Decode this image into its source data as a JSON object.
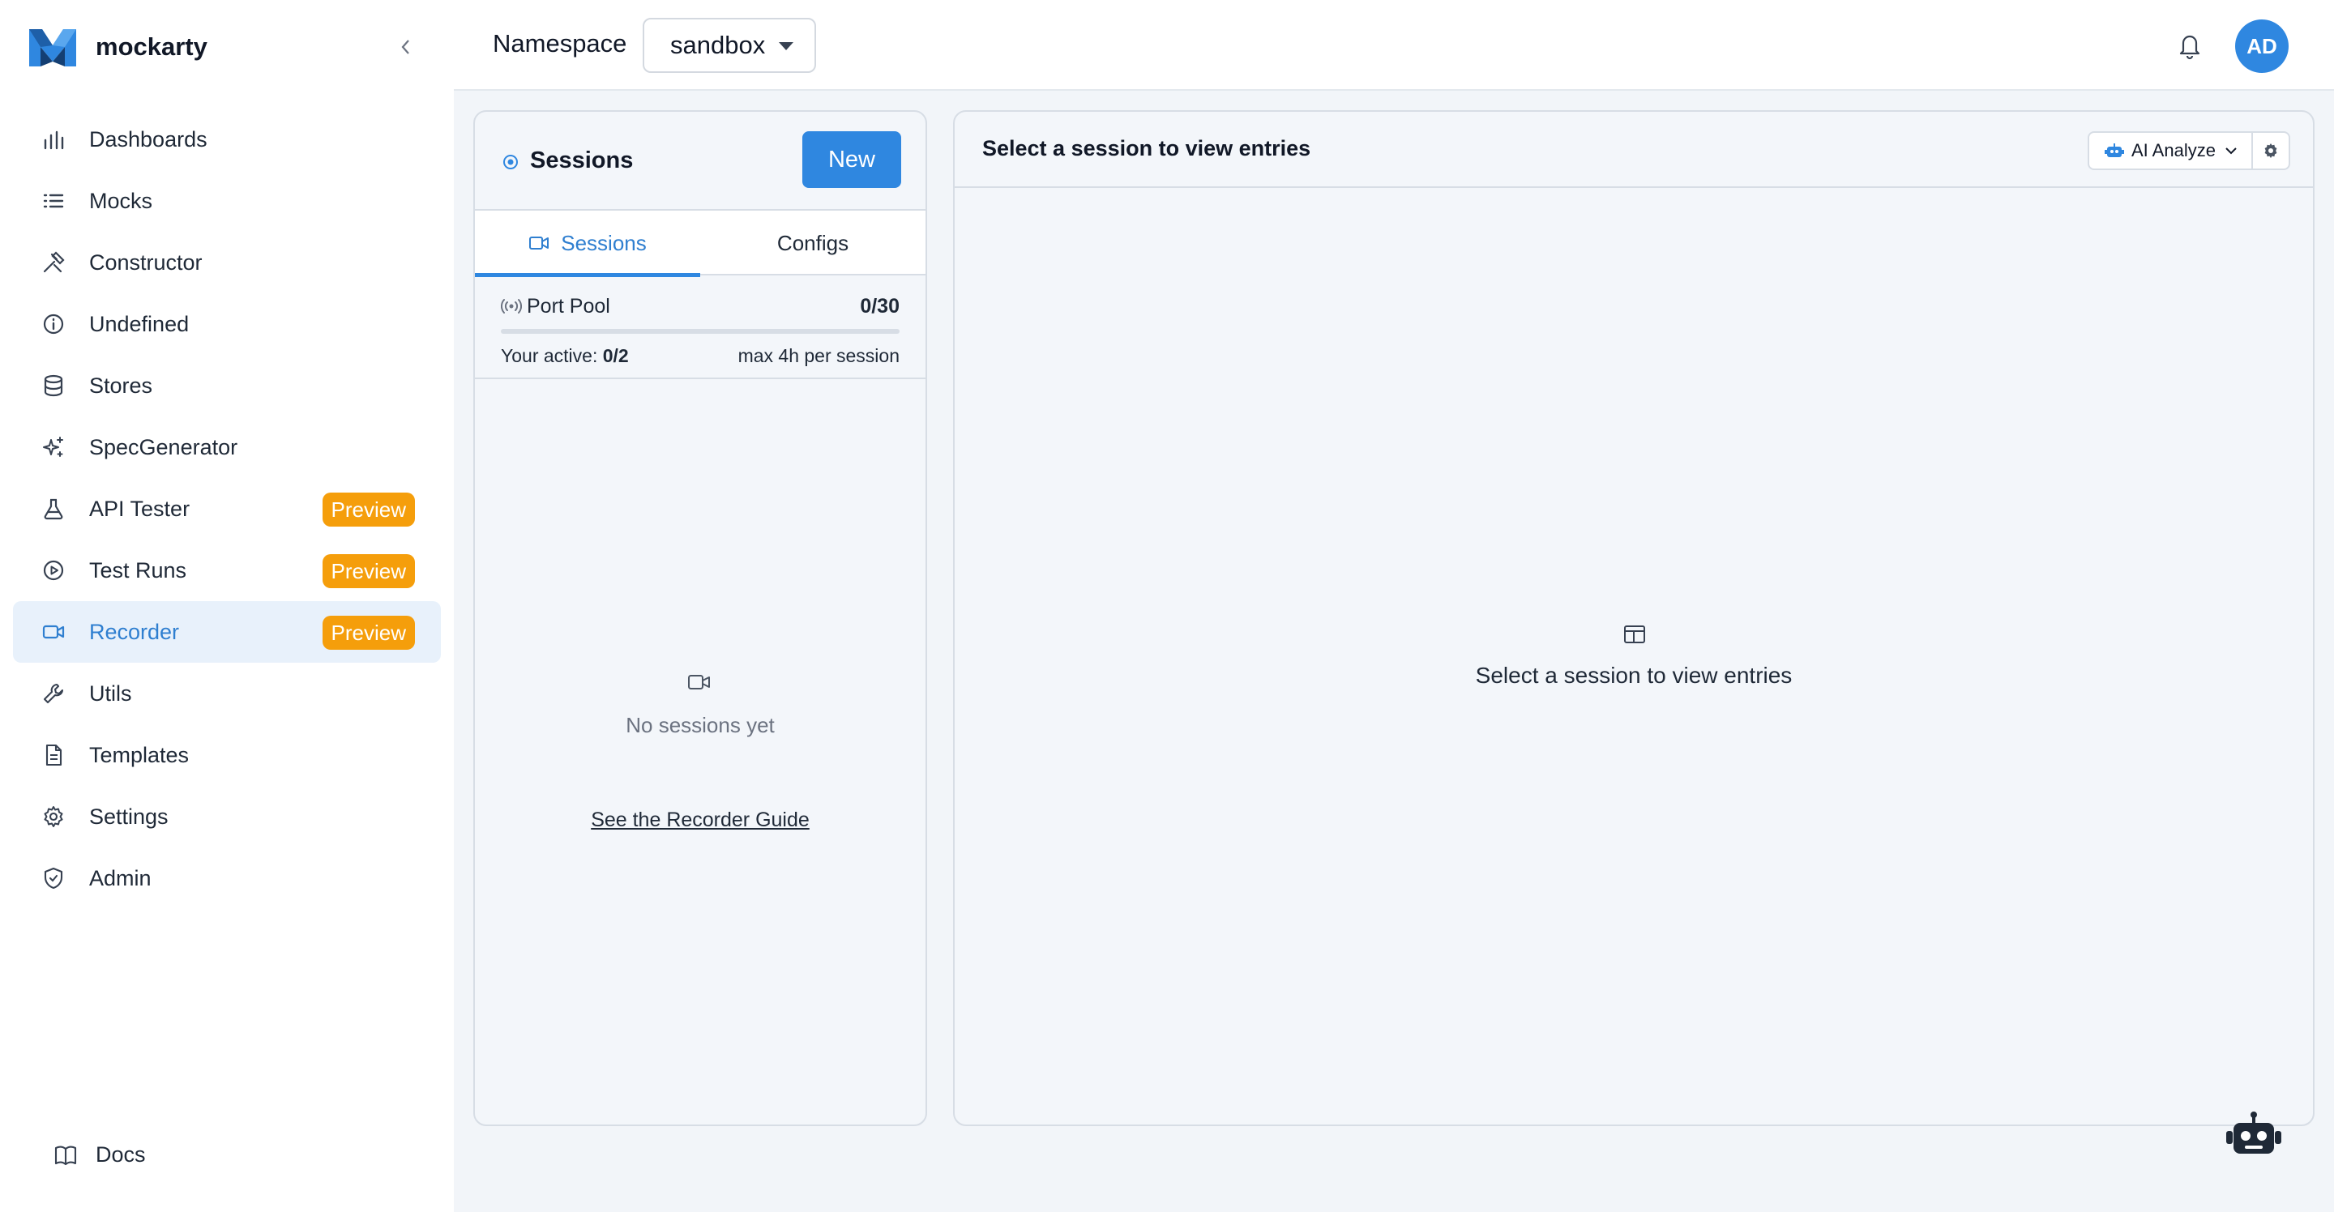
{
  "brand": {
    "name": "mockarty"
  },
  "nav": {
    "items": [
      {
        "label": "Dashboards",
        "icon": "bar-chart-icon"
      },
      {
        "label": "Mocks",
        "icon": "list-icon"
      },
      {
        "label": "Constructor",
        "icon": "tools-icon"
      },
      {
        "label": "Undefined",
        "icon": "info-icon"
      },
      {
        "label": "Stores",
        "icon": "database-icon"
      },
      {
        "label": "SpecGenerator",
        "icon": "sparkles-icon"
      },
      {
        "label": "API Tester",
        "icon": "flask-icon",
        "badge": "Preview"
      },
      {
        "label": "Test Runs",
        "icon": "play-circle-icon",
        "badge": "Preview"
      },
      {
        "label": "Recorder",
        "icon": "video-icon",
        "badge": "Preview",
        "active": true
      },
      {
        "label": "Utils",
        "icon": "wrench-icon"
      },
      {
        "label": "Templates",
        "icon": "file-icon"
      },
      {
        "label": "Settings",
        "icon": "gear-icon"
      },
      {
        "label": "Admin",
        "icon": "shield-icon"
      }
    ],
    "docs_label": "Docs"
  },
  "topbar": {
    "namespace_label": "Namespace",
    "namespace_value": "sandbox",
    "avatar_initials": "AD"
  },
  "sessions_panel": {
    "title": "Sessions",
    "new_label": "New",
    "tabs": [
      {
        "label": "Sessions",
        "active": true
      },
      {
        "label": "Configs",
        "active": false
      }
    ],
    "port_pool": {
      "label": "Port Pool",
      "count": "0/30",
      "used_fraction": 0,
      "active_prefix": "Your active:",
      "active_value": "0/2",
      "max_text": "max 4h per session"
    },
    "empty_text": "No sessions yet",
    "guide_link": "See the Recorder Guide"
  },
  "entries_panel": {
    "title": "Select a session to view entries",
    "ai_label": "AI Analyze",
    "empty_text": "Select a session to view entries"
  },
  "colors": {
    "accent": "#2f87e0",
    "badge": "#f59e0b",
    "active_bg": "#e8f1fb",
    "panel_bg": "#f3f6fa"
  }
}
